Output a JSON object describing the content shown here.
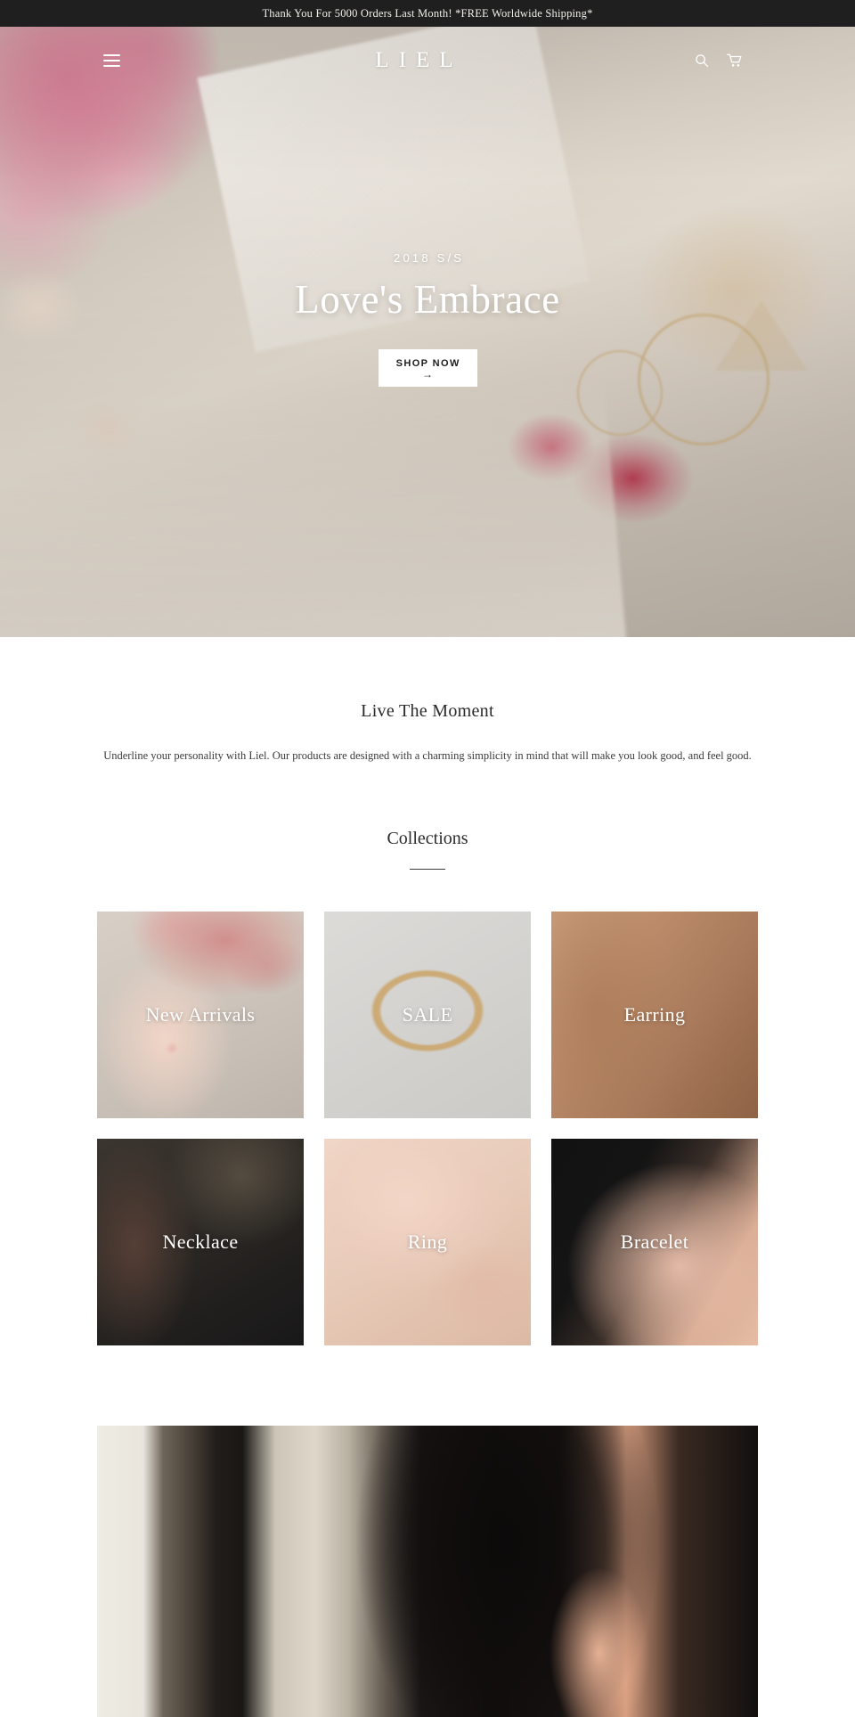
{
  "announcement": {
    "text": "Thank You For 5000 Orders Last Month! *FREE Worldwide Shipping*"
  },
  "header": {
    "logo": "LIEL",
    "menu_icon": "hamburger-menu-icon",
    "search_icon": "search-icon",
    "cart_icon": "shopping-cart-icon"
  },
  "hero": {
    "kicker": "2018 S/S",
    "title": "Love's Embrace",
    "button_label": "SHOP NOW",
    "button_arrow": "→"
  },
  "intro": {
    "heading": "Live The Moment",
    "body": "Underline your personality with Liel. Our products are designed with a charming simplicity in mind that will make you look good, and feel good."
  },
  "collections": {
    "heading": "Collections",
    "items": [
      {
        "label": "New Arrivals",
        "photo": "ph-new"
      },
      {
        "label": "SALE",
        "photo": "ph-sale"
      },
      {
        "label": "Earring",
        "photo": "ph-ear"
      },
      {
        "label": "Necklace",
        "photo": "ph-neck"
      },
      {
        "label": "Ring",
        "photo": "ph-ring"
      },
      {
        "label": "Bracelet",
        "photo": "ph-brac"
      }
    ]
  },
  "feature": {
    "alt": "woman-wearing-earring-photo"
  },
  "colors": {
    "announcement_bg": "#1f1f1f",
    "announcement_text": "#f2efe9",
    "page_bg": "#ffffff",
    "heading_text": "#2b2b2b",
    "body_text": "#3a3a3a",
    "hero_text": "#ffffff",
    "button_bg": "#ffffff",
    "button_text": "#1c1c1c"
  }
}
